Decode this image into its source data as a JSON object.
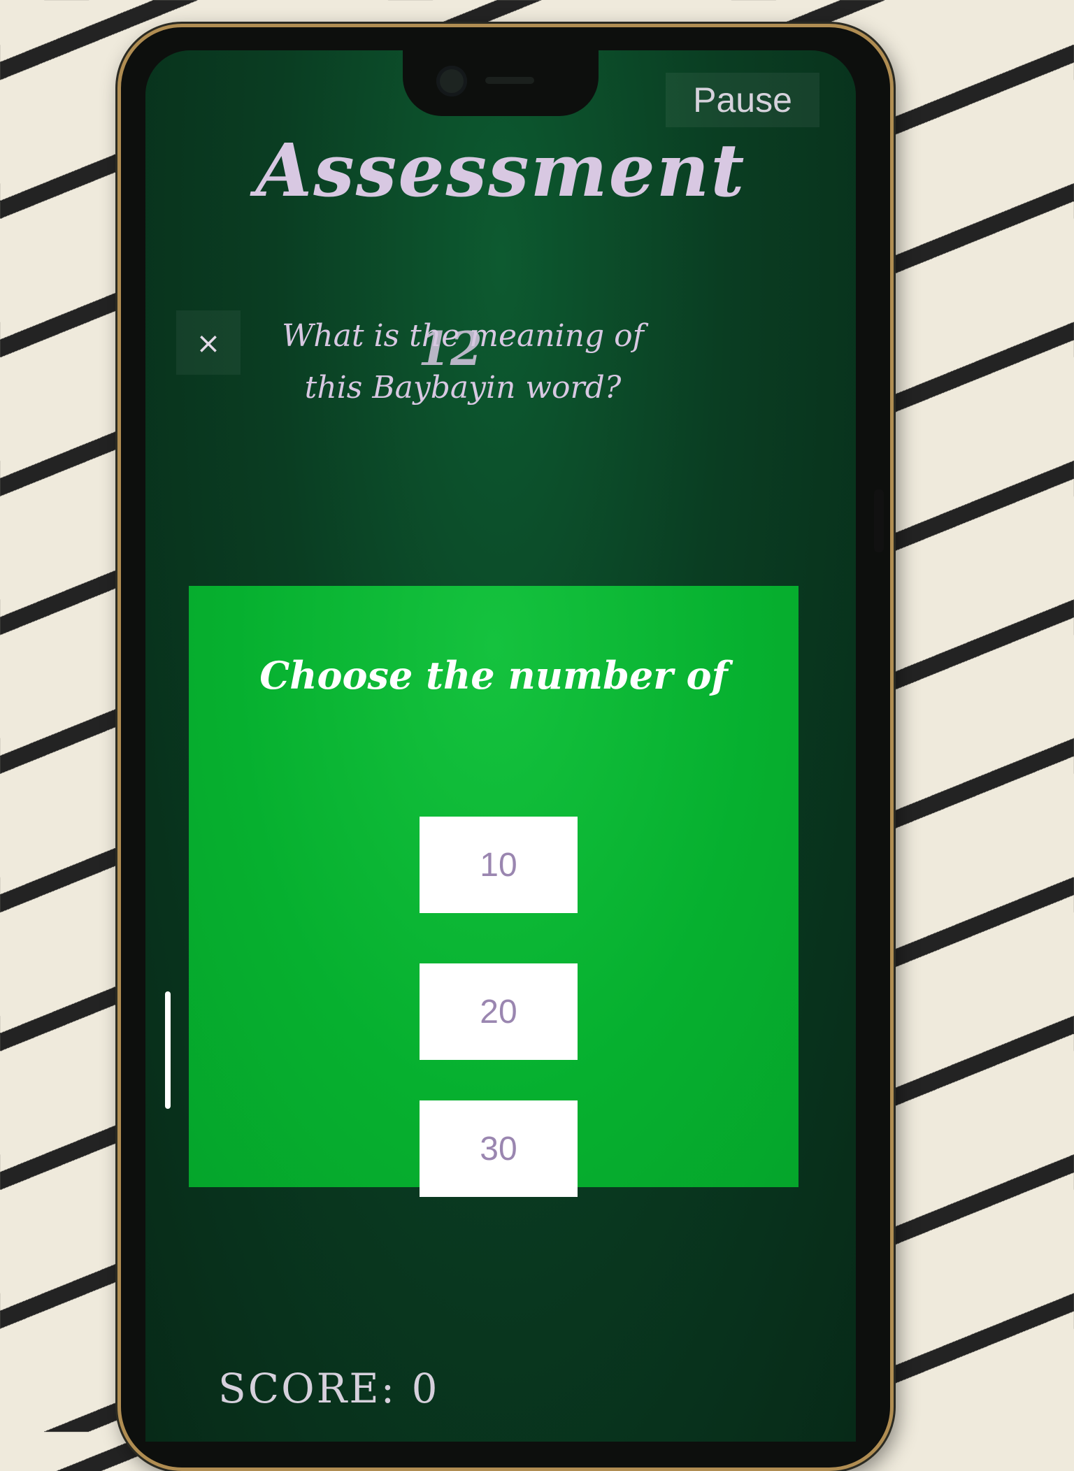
{
  "app": {
    "pause_label": "Pause",
    "title": "Assessment"
  },
  "question": {
    "close_symbol": "×",
    "line1": "What is the meaning of",
    "line2": "this Baybayin word?",
    "word": "12"
  },
  "panel": {
    "prompt": "Choose the number of",
    "options": [
      "10",
      "20",
      "30"
    ]
  },
  "score": {
    "label": "SCORE:",
    "value": "0"
  },
  "colors": {
    "panel_green": "#06b02f",
    "background_dark_green": "#0a3d22",
    "chalk_text": "#d8c8e2",
    "option_text": "#9a86b0"
  }
}
